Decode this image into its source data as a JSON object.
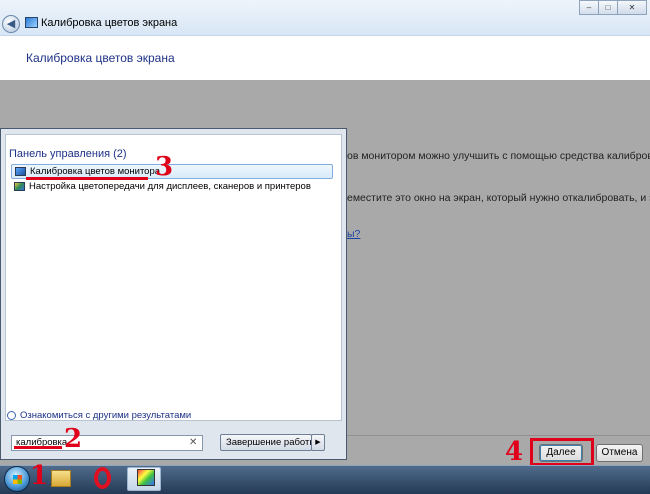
{
  "window": {
    "title": "Калибровка цветов экрана",
    "controls": [
      "–",
      "□",
      "✕"
    ]
  },
  "page": {
    "heading": "Калибровка цветов экрана",
    "text_lines": [
      "ов монитором можно улучшить с помощью средства калибровки",
      "еместите это окно на экран, который нужно откалибровать, и затем"
    ],
    "link_fragment": "ы?"
  },
  "footer": {
    "next_label": "Далее",
    "cancel_label": "Отмена"
  },
  "start_menu": {
    "group_header": "Панель управления (2)",
    "results": [
      "Калибровка цветов монитора",
      "Настройка цветопередачи для дисплеев, сканеров и принтеров"
    ],
    "more_results": "Ознакомиться с другими результатами",
    "search_value": "калибровка",
    "shutdown_label": "Завершение работы"
  },
  "annotations": [
    "1",
    "2",
    "3",
    "4"
  ],
  "icons": {
    "back": "back-arrow-icon",
    "start": "windows-orb-icon",
    "explorer": "folder-icon",
    "opera": "opera-icon",
    "control_panel": "control-panel-icon"
  }
}
